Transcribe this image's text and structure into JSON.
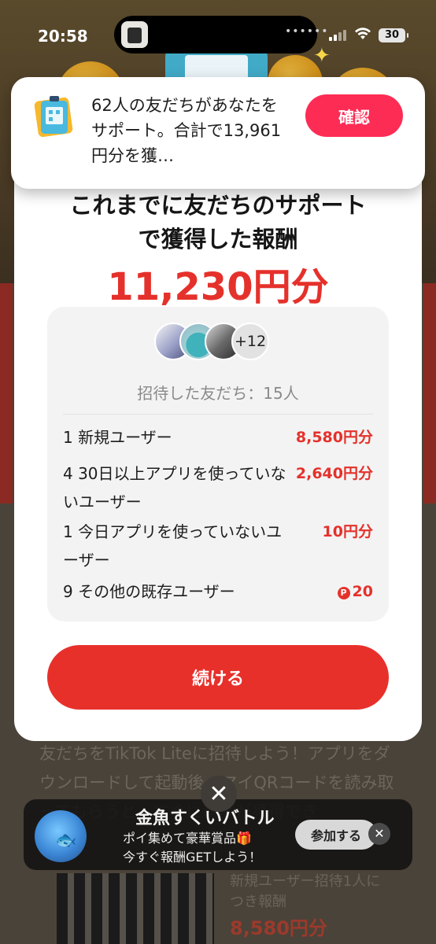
{
  "status_bar": {
    "time": "20:58",
    "battery": "30",
    "island_dots": "••••••"
  },
  "toast": {
    "icon": "qr-card-icon",
    "message": "62人の友だちがあなたをサポート。合計で13,961円分を獲…",
    "confirm_label": "確認",
    "confirm_color": "#fd2c55"
  },
  "modal": {
    "title_line1": "これまでに友だちのサポート",
    "title_line2": "で獲得した報酬",
    "reward_amount": "11,230円分",
    "accent_color": "#e5312b",
    "avatars": {
      "more_count": "+12"
    },
    "invited_label": "招待した友だち：15人",
    "rows": [
      {
        "label": "1 新規ユーザー",
        "value": "8,580円分"
      },
      {
        "label": "4 30日以上アプリを使っていないユーザー",
        "value": "2,640円分"
      },
      {
        "label": "1 今日アプリを使っていないユーザー",
        "value": "10円分"
      },
      {
        "label": "9 その他の既存ユーザー",
        "value": "20",
        "point_icon": "P"
      }
    ],
    "continue_label": "続ける"
  },
  "close_label": "✕",
  "background": {
    "text": "友だちをTikTok Liteに招待しよう！アプリをダウンロードして起動後、マイQRコードを読み取ってもらうと、すぐに報酬が獲得でき",
    "qr_text": "新規ユーザー招待1人につき報酬",
    "qr_amount": "8,580円分"
  },
  "banner": {
    "title": "金魚すくいバトル",
    "line1": "ポイ集めて豪華賞品🎁",
    "line2": "今すぐ報酬GETしよう！",
    "join_label": "参加する",
    "close_label": "✕"
  }
}
